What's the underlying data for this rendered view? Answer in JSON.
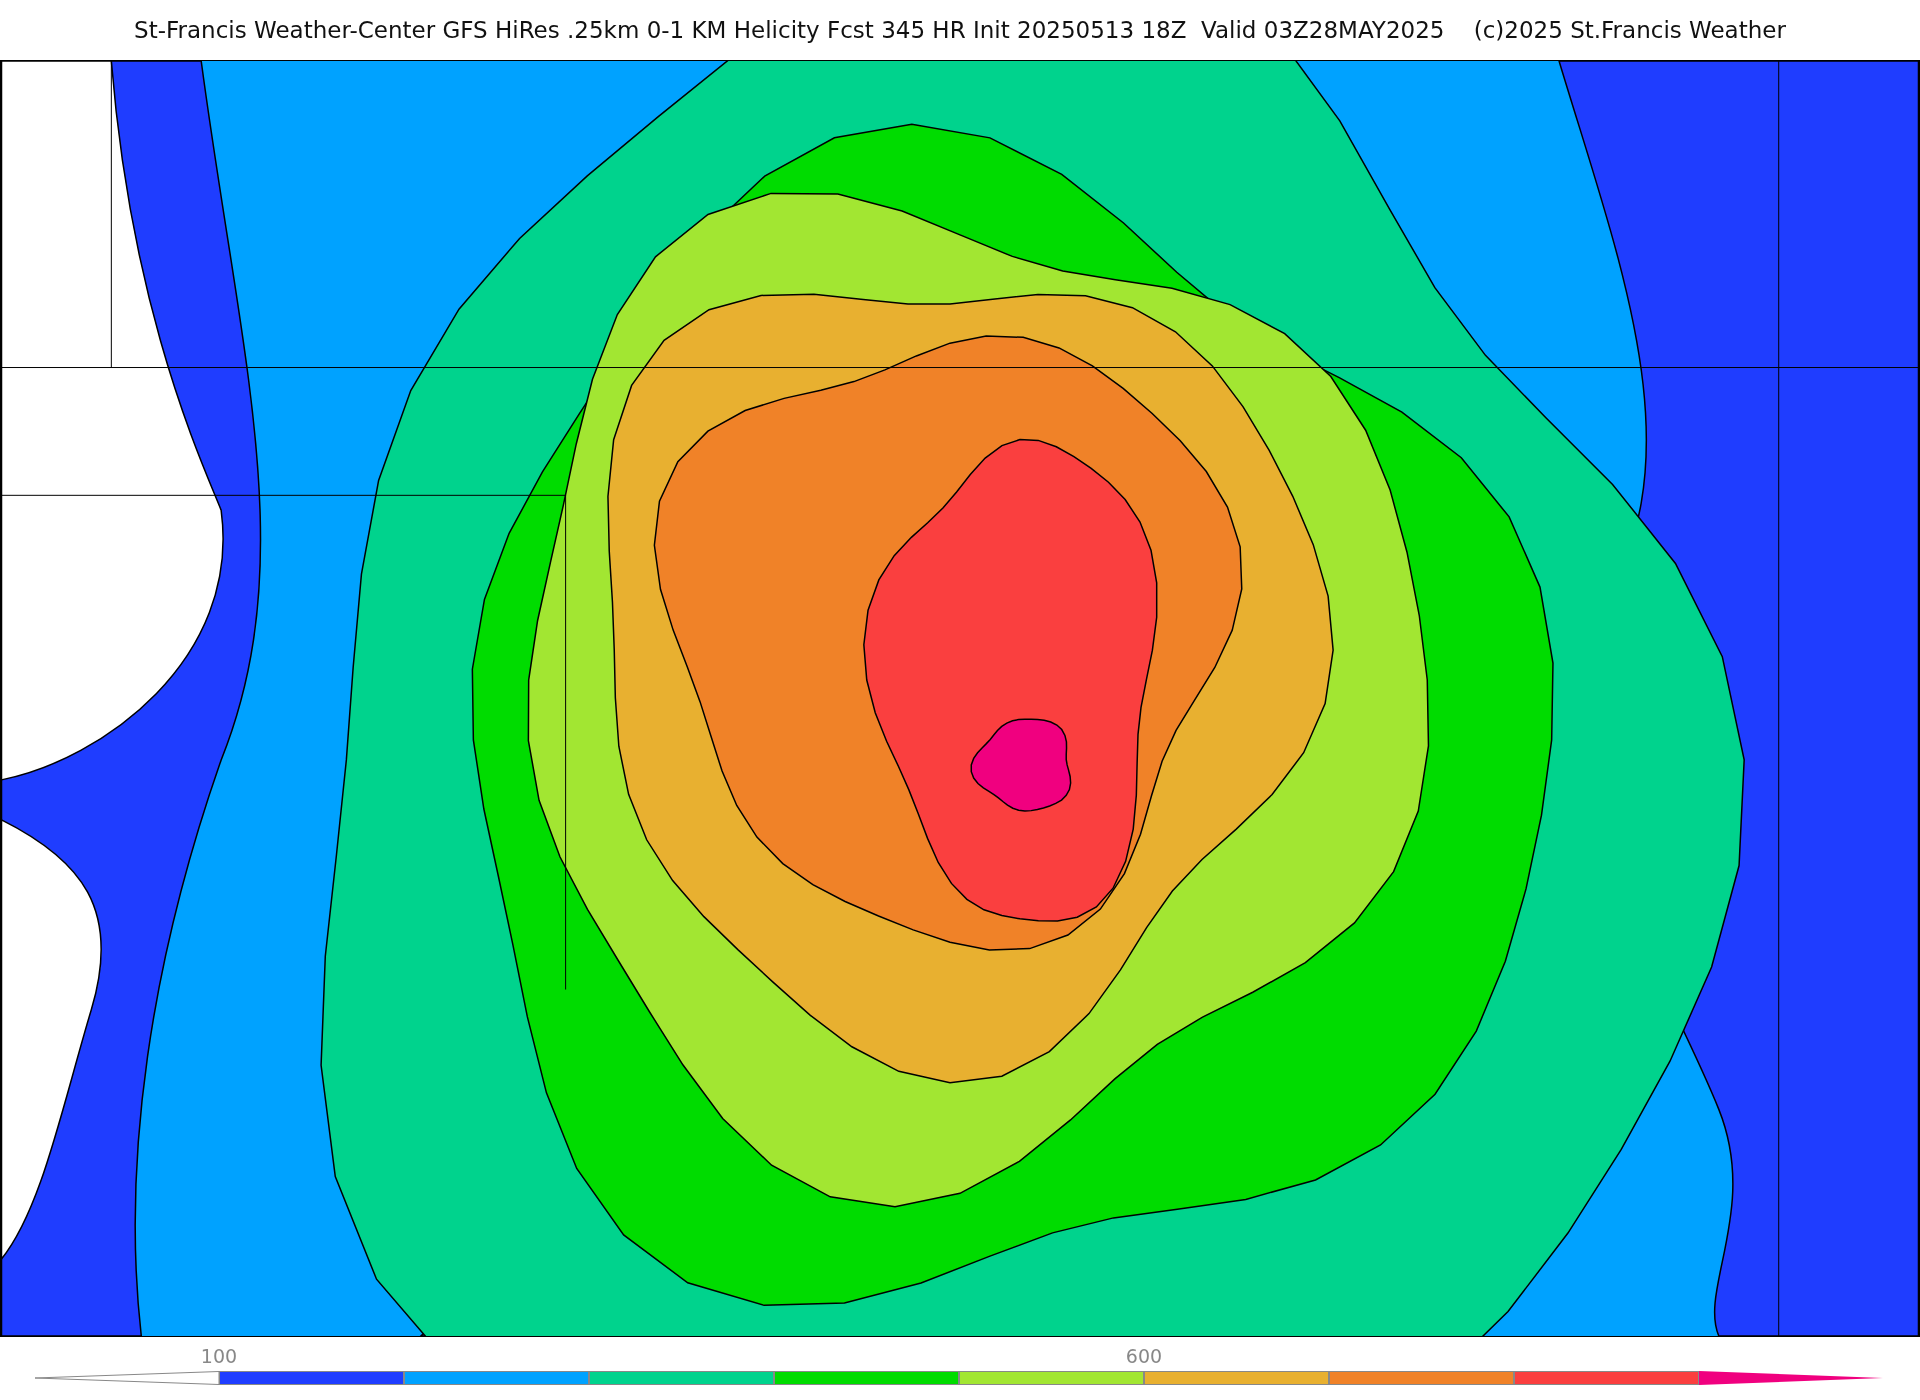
{
  "title": "St-Francis Weather-Center GFS HiRes .25km 0-1 KM Helicity Fcst 345 HR Init 20250513 18Z  Valid 03Z28MAY2025    (c)2025 St.Francis Weather",
  "colorbar": {
    "bins": [
      {
        "kind": "under",
        "color": "#ffffff"
      },
      {
        "kind": "bin",
        "color": "#1f3dff",
        "tick_label": "100"
      },
      {
        "kind": "bin",
        "color": "#00a2ff"
      },
      {
        "kind": "bin",
        "color": "#00d38d"
      },
      {
        "kind": "bin",
        "color": "#00dc00"
      },
      {
        "kind": "bin",
        "color": "#a2e632"
      },
      {
        "kind": "bin",
        "color": "#e8b030",
        "tick_label": "600"
      },
      {
        "kind": "bin",
        "color": "#f08228"
      },
      {
        "kind": "bin",
        "color": "#fa3f3f"
      },
      {
        "kind": "over",
        "color": "#f0007f"
      }
    ]
  }
}
